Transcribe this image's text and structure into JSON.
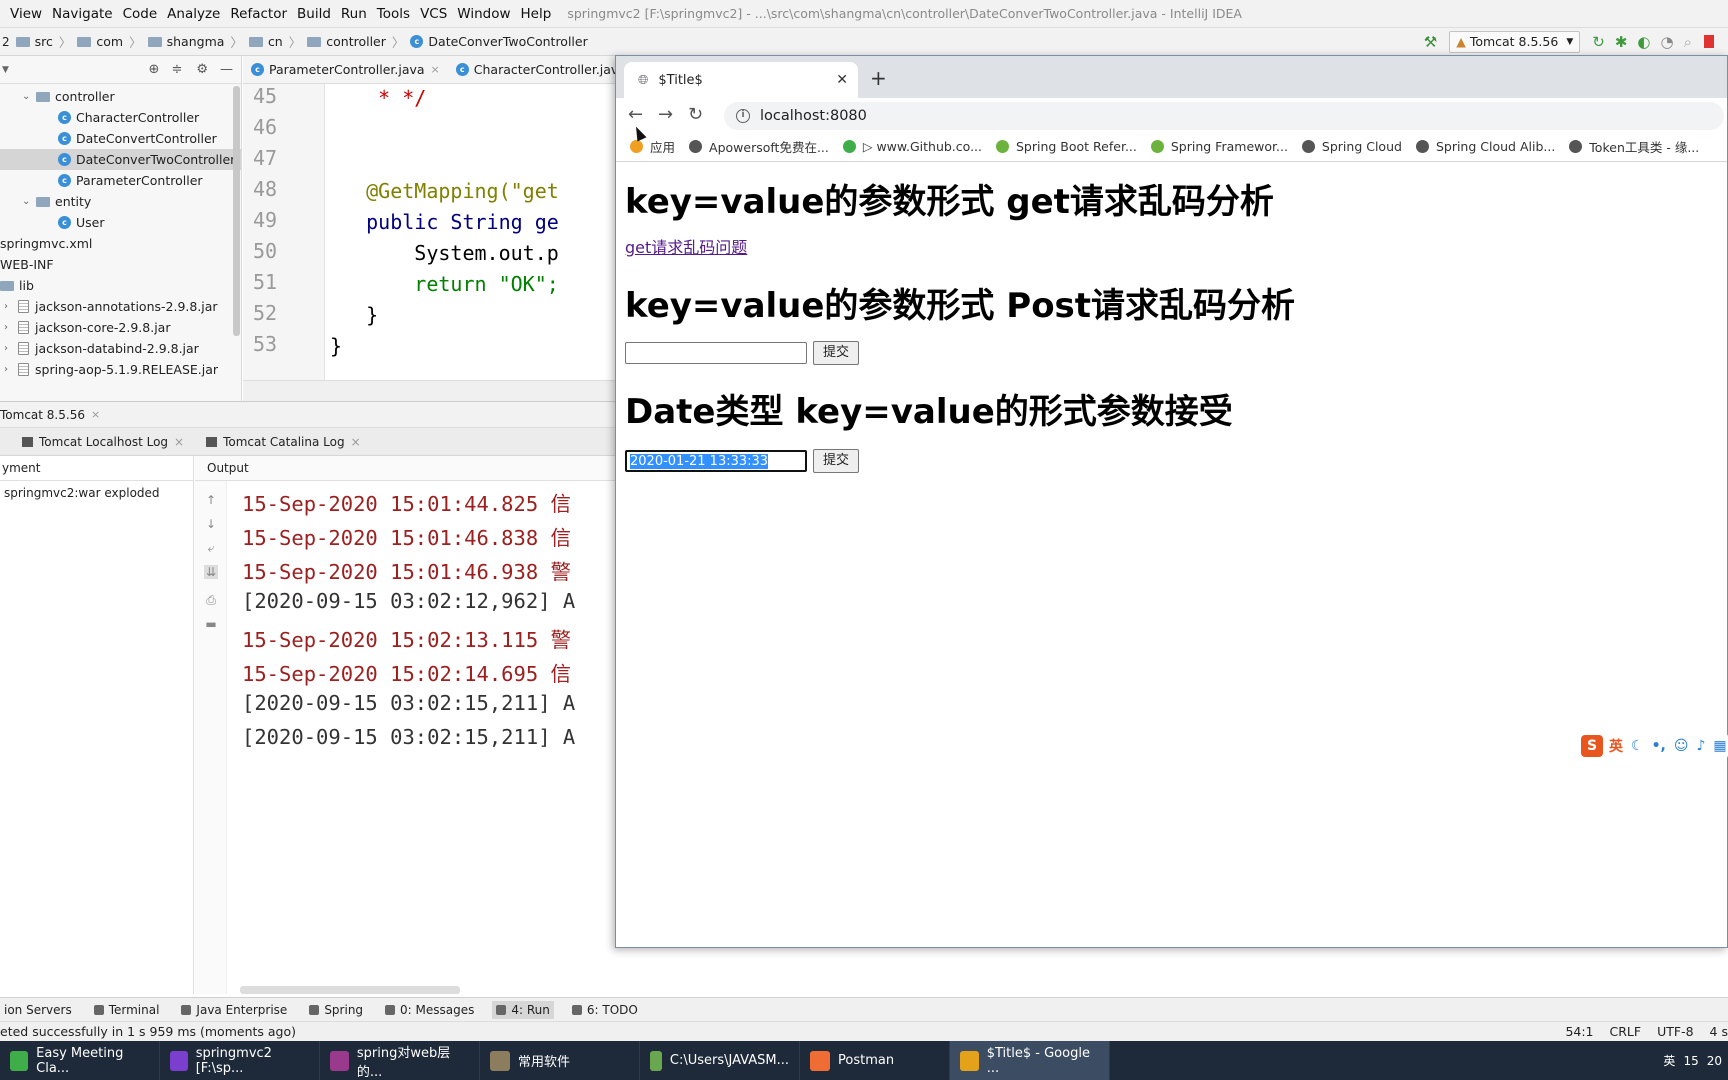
{
  "ide": {
    "menu": [
      "View",
      "Navigate",
      "Code",
      "Analyze",
      "Refactor",
      "Build",
      "Run",
      "Tools",
      "VCS",
      "Window",
      "Help"
    ],
    "window_title": "springmvc2 [F:\\springmvc2] - ...\\src\\com\\shangma\\cn\\controller\\DateConverTwoController.java - IntelliJ IDEA",
    "breadcrumb": [
      "src",
      "com",
      "shangma",
      "cn",
      "controller",
      "DateConverTwoController"
    ],
    "run_config": "Tomcat 8.5.56",
    "project_tree": [
      {
        "label": "controller",
        "indent": 22,
        "type": "folder",
        "arrow": "v"
      },
      {
        "label": "CharacterController",
        "indent": 58,
        "type": "class"
      },
      {
        "label": "DateConvertController",
        "indent": 58,
        "type": "class"
      },
      {
        "label": "DateConverTwoController",
        "indent": 58,
        "type": "class",
        "selected": true
      },
      {
        "label": "ParameterController",
        "indent": 58,
        "type": "class"
      },
      {
        "label": "entity",
        "indent": 22,
        "type": "folder",
        "arrow": "v"
      },
      {
        "label": "User",
        "indent": 58,
        "type": "class"
      },
      {
        "label": "springmvc.xml",
        "indent": 0,
        "type": "text"
      },
      {
        "label": "WEB-INF",
        "indent": 0,
        "type": "text"
      },
      {
        "label": "lib",
        "indent": 0,
        "type": "folder"
      },
      {
        "label": "jackson-annotations-2.9.8.jar",
        "indent": 4,
        "type": "jar",
        "arrow": ">"
      },
      {
        "label": "jackson-core-2.9.8.jar",
        "indent": 4,
        "type": "jar",
        "arrow": ">"
      },
      {
        "label": "jackson-databind-2.9.8.jar",
        "indent": 4,
        "type": "jar",
        "arrow": ">"
      },
      {
        "label": "spring-aop-5.1.9.RELEASE.jar",
        "indent": 4,
        "type": "jar",
        "arrow": ">"
      }
    ],
    "editor_tabs": [
      "ParameterController.java",
      "CharacterController.java"
    ],
    "code_lines": [
      {
        "n": "45",
        "text": "    * */"
      },
      {
        "n": "46",
        "text": ""
      },
      {
        "n": "47",
        "text": ""
      },
      {
        "n": "48",
        "text": "   @GetMapping(\"get"
      },
      {
        "n": "49",
        "text": "   public String ge"
      },
      {
        "n": "50",
        "text": "       System.out.p"
      },
      {
        "n": "51",
        "text": "       return \"OK\";"
      },
      {
        "n": "52",
        "text": "   }"
      },
      {
        "n": "53",
        "text": "}"
      }
    ],
    "run_title": "Tomcat 8.5.56",
    "run_tabs": [
      "Tomcat Localhost Log",
      "Tomcat Catalina Log"
    ],
    "services_header": "yment",
    "services_item": "springmvc2:war exploded",
    "output_label": "Output",
    "log_lines": [
      {
        "text": "15-Sep-2020 15:01:44.825 信",
        "kind": "r"
      },
      {
        "text": "15-Sep-2020 15:01:46.838 信",
        "kind": "r"
      },
      {
        "text": "15-Sep-2020 15:01:46.938 警",
        "kind": "r"
      },
      {
        "text": "[2020-09-15 03:02:12,962] A",
        "kind": "g"
      },
      {
        "text": "15-Sep-2020 15:02:13.115 警",
        "kind": "r"
      },
      {
        "text": "15-Sep-2020 15:02:14.695 信",
        "kind": "r"
      },
      {
        "text": "[2020-09-15 03:02:15,211] A",
        "kind": "g"
      },
      {
        "text": "[2020-09-15 03:02:15,211] A",
        "kind": "g"
      }
    ],
    "bottom_tabs": [
      "ion Servers",
      "Terminal",
      "Java Enterprise",
      "Spring",
      "0: Messages",
      "4: Run",
      "6: TODO"
    ],
    "status_left": "eted successfully in 1 s 959 ms (moments ago)",
    "status_right": [
      "54:1",
      "CRLF",
      "UTF-8",
      "4 s"
    ]
  },
  "browser": {
    "tab_title": "$Title$",
    "url": "localhost:8080",
    "bookmarks": [
      "应用",
      "Apowersoft免费在...",
      "▷ www.Github.co...",
      "Spring Boot Refer...",
      "Spring Framewor...",
      "Spring Cloud",
      "Spring Cloud Alib...",
      "Token工具类 - 缘..."
    ],
    "heading1": "key=value的参数形式 get请求乱码分析",
    "link1": "get请求乱码问题",
    "heading2": "key=value的参数形式 Post请求乱码分析",
    "input1": "",
    "submit1": "提交",
    "heading3": "Date类型 key=value的形式参数接受",
    "input2": "2020-01-21 13:33:33",
    "submit2": "提交"
  },
  "ime_label": "英",
  "taskbar": {
    "items": [
      {
        "label": "Easy Meeting Cla...",
        "color": "#3fae4a"
      },
      {
        "label": "springmvc2 [F:\\sp...",
        "color": "#7b3fd0"
      },
      {
        "label": "spring对web层的...",
        "color": "#9a3a8c"
      },
      {
        "label": "常用软件",
        "color": "#8c7d5e"
      },
      {
        "label": "C:\\Users\\JAVASM...",
        "color": "#6aa84f"
      },
      {
        "label": "Postman",
        "color": "#ef6c35"
      },
      {
        "label": "$Title$ - Google ...",
        "color": "#e3a21a",
        "active": true
      }
    ],
    "tray": [
      "英",
      "15",
      "20"
    ]
  }
}
